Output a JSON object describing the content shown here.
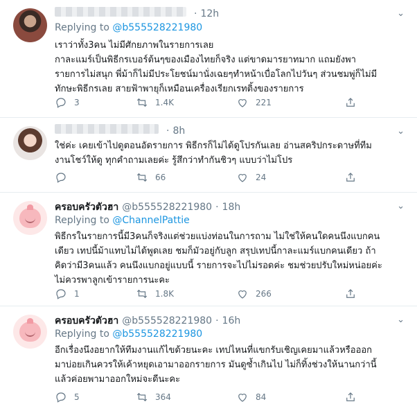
{
  "labels": {
    "replying_to": "Replying to"
  },
  "tweets": [
    {
      "author_display": "",
      "author_handle": "",
      "time": "12h",
      "replying_to": "@b555528221980",
      "lines": [
        "เราว่าทั้ง3คน ไม่มีศักยภาพในรายการเลย",
        "กาละแมร์เป็นพิธีกรเบอร์ต้นๆของเมืองไทยก็จริง แต่ขาดมารยาทมาก แถมยังพา",
        "รายการไม่สนุก พี่ม้าก็ไม่มีประโยชน์มานั่งเฉยๆทำหน้าเบื่อโลกไปวันๆ ส่วนชมพู่ก็ไม่มี",
        "ทักษะพิธีกรเลย สายฟ้าพายุก็เหมือนเครื่องเรียกเรทติ้งของรายการ"
      ],
      "replies": "3",
      "retweets": "1.4K",
      "likes": "221"
    },
    {
      "author_display": "",
      "author_handle": "",
      "time": "8h",
      "replying_to": "",
      "lines": [
        "ใช่ค่ะ เคยเข้าไปดูตอนอัดรายการ พิธีกรก็ไม่ได้ดูโปรกันเลย อ่านสคริปกระดาษที่ทีม",
        "งานโชว์ให้ดู ทุกคำถามเลยค่ะ รู้สึกว่าทำกันชิวๆ แบบว่าไม่โปร"
      ],
      "replies": "",
      "retweets": "66",
      "likes": "24"
    },
    {
      "author_display": "ครอบครัวตัวฮา",
      "author_handle": "@b555528221980",
      "time": "18h",
      "replying_to": "@ChannelPattie",
      "lines": [
        "พิธีกรในรายการนี้มี3คนก็จริงแต่ช่วยแบ่งท่อนในการถาม ไม่ใช่ให้คนใดคนนึงแบกคน",
        "เดียว เทปนี้ม้าแทบไม่ได้พูดเลย ชมก็มัวอยู่กับลูก สรุปเทปนี้กาละแมร์แบกคนเดียว ถ้า",
        "คิดว่ามี3คนแล้ว คนนึงแบกอยู่แบบนี้ รายการจะไปไม่รอดค่ะ ชมช่วยปรับใหม่หน่อยค่ะ",
        "ไม่ควรพาลูกเข้ารายการนะคะ"
      ],
      "replies": "1",
      "retweets": "1.8K",
      "likes": "266"
    },
    {
      "author_display": "ครอบครัวตัวฮา",
      "author_handle": "@b555528221980",
      "time": "16h",
      "replying_to": "@b555528221980",
      "lines": [
        "อีกเรื่องนึงอยากให้ทีมงานแก้ไขด้วยนะคะ เทปไหนที่แขกรับเชิญเคยมาแล้วหรือออก",
        "มาบ่อยเกินควรให้เค้าหยุดเอามาออกรายการ มันดูซ้ำเกินไป ไม่ก็ทิ้งช่วงให้นานกว่านี้",
        "แล้วค่อยพามาออกใหม่จะดีนะคะ"
      ],
      "replies": "5",
      "retweets": "364",
      "likes": "84"
    }
  ]
}
